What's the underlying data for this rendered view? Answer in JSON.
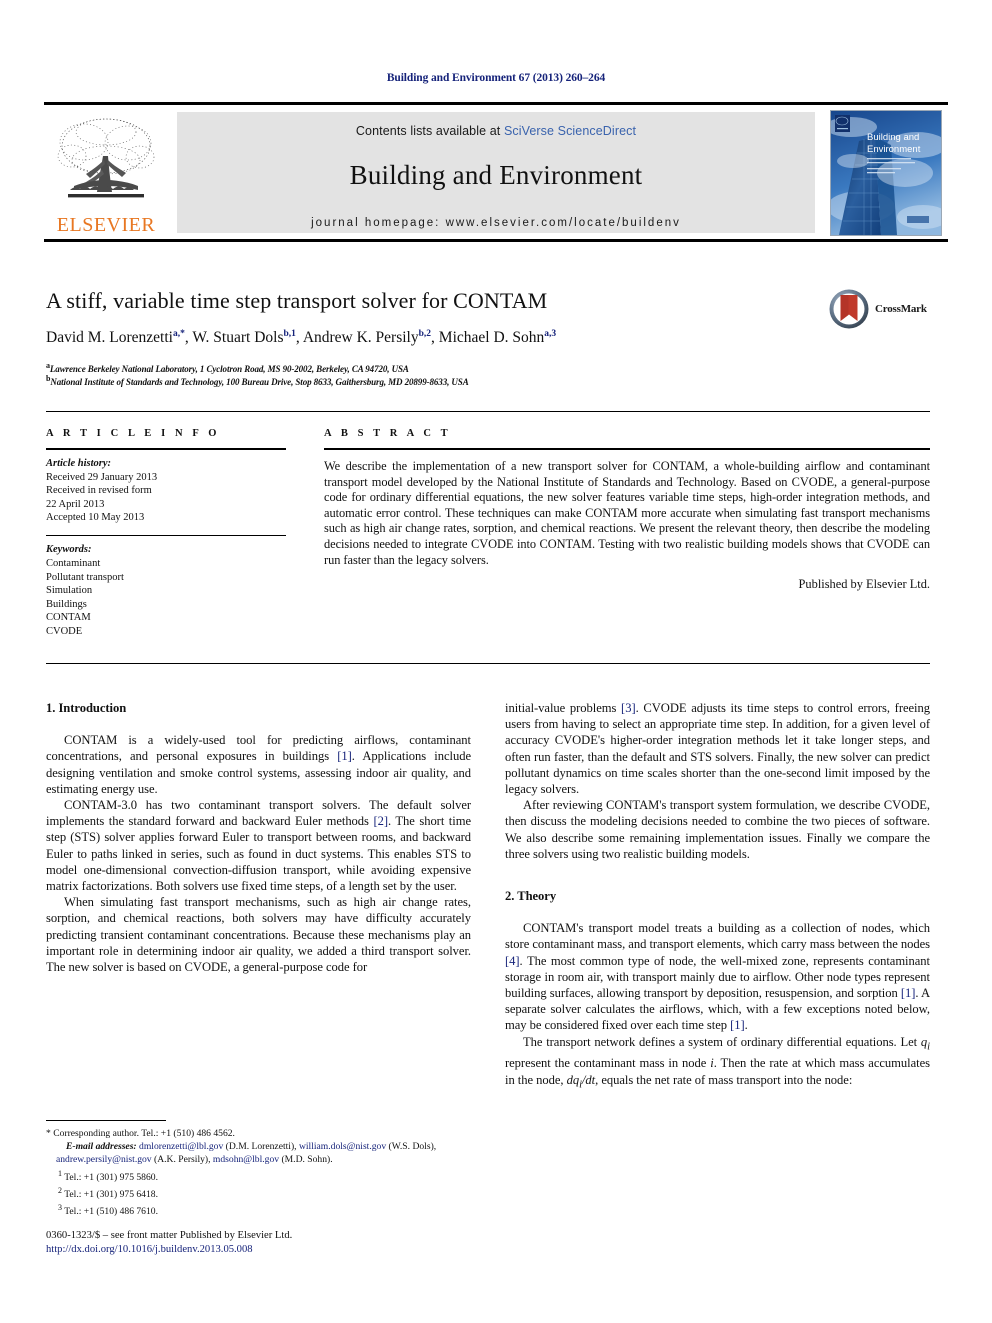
{
  "running_head": "Building and Environment 67 (2013) 260–264",
  "masthead": {
    "publisher_name": "ELSEVIER",
    "contents_prefix": "Contents lists available at ",
    "contents_link": "SciVerse ScienceDirect",
    "journal_title": "Building and Environment",
    "homepage": "journal homepage: www.elsevier.com/locate/buildenv",
    "cover_title_line1": "Building and",
    "cover_title_line2": "Environment"
  },
  "article": {
    "title": "A stiff, variable time step transport solver for CONTAM",
    "authors": "David M. Lorenzetti",
    "authors_full": [
      {
        "name": "David M. Lorenzetti",
        "marks": "a,*"
      },
      {
        "name": "W. Stuart Dols",
        "marks": "b,1"
      },
      {
        "name": "Andrew K. Persily",
        "marks": "b,2"
      },
      {
        "name": "Michael D. Sohn",
        "marks": "a,3"
      }
    ],
    "affiliation_a_mark": "a",
    "affiliation_a": "Lawrence Berkeley National Laboratory, 1 Cyclotron Road, MS 90-2002, Berkeley, CA 94720, USA",
    "affiliation_b_mark": "b",
    "affiliation_b": "National Institute of Standards and Technology, 100 Bureau Drive, Stop 8633, Gaithersburg, MD 20899-8633, USA",
    "crossmark_label": "CrossMark"
  },
  "article_info": {
    "heading": "A R T I C L E  I N F O",
    "history_label": "Article history:",
    "history": [
      "Received 29 January 2013",
      "Received in revised form",
      "22 April 2013",
      "Accepted 10 May 2013"
    ],
    "keywords_label": "Keywords:",
    "keywords": [
      "Contaminant",
      "Pollutant transport",
      "Simulation",
      "Buildings",
      "CONTAM",
      "CVODE"
    ]
  },
  "abstract": {
    "heading": "A B S T R A C T",
    "text": "We describe the implementation of a new transport solver for CONTAM, a whole-building airflow and contaminant transport model developed by the National Institute of Standards and Technology. Based on CVODE, a general-purpose code for ordinary differential equations, the new solver features variable time steps, high-order integration methods, and automatic error control. These techniques can make CONTAM more accurate when simulating fast transport mechanisms such as high air change rates, sorption, and chemical reactions. We present the relevant theory, then describe the modeling decisions needed to integrate CVODE into CONTAM. Testing with two realistic building models shows that CVODE can run faster than the legacy solvers.",
    "publisher_line": "Published by Elsevier Ltd."
  },
  "sections": {
    "introduction_heading": "1.  Introduction",
    "intro_p1_a": "CONTAM is a widely-used tool for predicting airflows, contaminant concentrations, and personal exposures in buildings ",
    "intro_p1_ref": "[1]",
    "intro_p1_b": ". Applications include designing ventilation and smoke control systems, assessing indoor air quality, and estimating energy use.",
    "intro_p2_a": "CONTAM-3.0 has two contaminant transport solvers. The default solver implements the standard forward and backward Euler methods ",
    "intro_p2_ref": "[2]",
    "intro_p2_b": ". The short time step (STS) solver applies forward Euler to transport between rooms, and backward Euler to paths linked in series, such as found in duct systems. This enables STS to model one-dimensional convection-diffusion transport, while avoiding expensive matrix factorizations. Both solvers use fixed time steps, of a length set by the user.",
    "intro_p3": "When simulating fast transport mechanisms, such as high air change rates, sorption, and chemical reactions, both solvers may have difficulty accurately predicting transient contaminant concentrations. Because these mechanisms play an important role in determining indoor air quality, we added a third transport solver. The new solver is based on CVODE, a general-purpose code for",
    "intro_p4_a": "initial-value problems ",
    "intro_p4_ref": "[3]",
    "intro_p4_b": ". CVODE adjusts its time steps to control errors, freeing users from having to select an appropriate time step. In addition, for a given level of accuracy CVODE's higher-order integration methods let it take longer steps, and often run faster, than the default and STS solvers. Finally, the new solver can predict pollutant dynamics on time scales shorter than the one-second limit imposed by the legacy solvers.",
    "intro_p5": "After reviewing CONTAM's transport system formulation, we describe CVODE, then discuss the modeling decisions needed to combine the two pieces of software. We also describe some remaining implementation issues. Finally we compare the three solvers using two realistic building models.",
    "theory_heading": "2.  Theory",
    "theory_p1_a": "CONTAM's transport model treats a building as a collection of nodes, which store contaminant mass, and transport elements, which carry mass between the nodes ",
    "theory_p1_ref1": "[4]",
    "theory_p1_b": ". The most common type of node, the well-mixed zone, represents contaminant storage in room air, with transport mainly due to airflow. Other node types represent building surfaces, allowing transport by deposition, resuspension, and sorption ",
    "theory_p1_ref2": "[1]",
    "theory_p1_c": ". A separate solver calculates the airflows, which, with a few exceptions noted below, may be considered fixed over each time step ",
    "theory_p1_ref3": "[1]",
    "theory_p1_d": ".",
    "theory_p2_a": "The transport network defines a system of ordinary differential equations. Let ",
    "theory_p2_var1": "q",
    "theory_p2_sub1": "i",
    "theory_p2_b": " represent the contaminant mass in node ",
    "theory_p2_var2": "i",
    "theory_p2_c": ". Then the rate at which mass accumulates in the node, ",
    "theory_p2_var3": "dq",
    "theory_p2_sub3": "i",
    "theory_p2_var4": "/dt",
    "theory_p2_d": ", equals the net rate of mass transport into the node:"
  },
  "footnotes": {
    "corresponding": "* Corresponding author. Tel.: +1 (510) 486 4562.",
    "email_label": "E-mail addresses:",
    "email_1": "dmlorenzetti@lbl.gov",
    "email_1_who": " (D.M. Lorenzetti), ",
    "email_2": "william.dols@nist.gov",
    "email_2_who": " (W.S. Dols), ",
    "email_3": "andrew.persily@nist.gov",
    "email_3_who": " (A.K. Persily), ",
    "email_4": "mdsohn@lbl.gov",
    "email_4_who": " (M.D. Sohn).",
    "tel_1_mark": "1",
    "tel_1": "Tel.: +1 (301) 975 5860.",
    "tel_2_mark": "2",
    "tel_2": "Tel.: +1 (301) 975 6418.",
    "tel_3_mark": "3",
    "tel_3": "Tel.: +1 (510) 486 7610."
  },
  "copyright": {
    "line1": "0360-1323/$ – see front matter Published by Elsevier Ltd.",
    "doi": "http://dx.doi.org/10.1016/j.buildenv.2013.05.008"
  },
  "colors": {
    "link_blue": "#16237a",
    "sciverse_blue": "#3a63ad",
    "elsevier_orange": "#E87722",
    "band_gray": "#e3e3e3"
  }
}
